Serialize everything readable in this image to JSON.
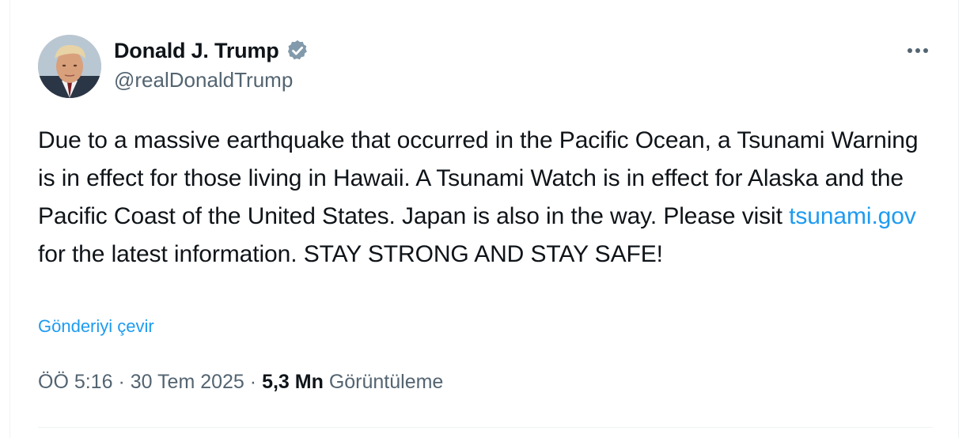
{
  "author": {
    "display_name": "Donald J. Trump",
    "handle": "@realDonaldTrump",
    "verified_icon": "verified-badge-icon",
    "verified_color": "#829aab"
  },
  "tweet": {
    "text_before_link": "Due to a massive earthquake that occurred in the Pacific Ocean, a Tsunami Warning is in effect for those living in Hawaii. A Tsunami Watch is in effect for Alaska and the Pacific Coast of the United States. Japan is also in the way. Please visit ",
    "link_text": "tsunami.gov",
    "text_after_link": " for the latest information. STAY STRONG AND STAY SAFE!",
    "translate_label": "Gönderiyi çevir"
  },
  "meta": {
    "time": "ÖÖ 5:16",
    "separator": "·",
    "date": "30 Tem 2025",
    "views_count": "5,3 Mn",
    "views_label": "Görüntüleme"
  },
  "colors": {
    "link": "#1d9bf0",
    "secondary_text": "#536471",
    "primary_text": "#0f1419"
  },
  "icons": {
    "more": "more-horizontal-icon",
    "verified": "verified-badge-icon"
  }
}
